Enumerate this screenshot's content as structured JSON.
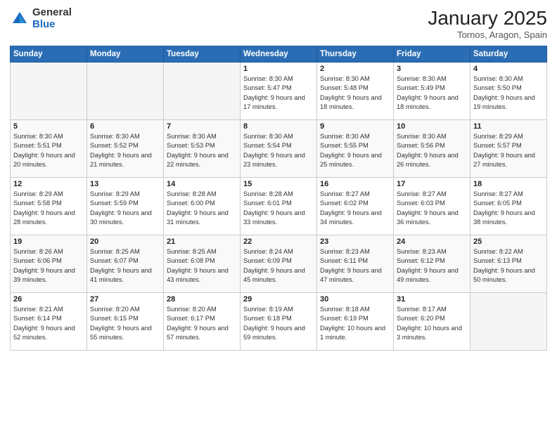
{
  "header": {
    "logo_general": "General",
    "logo_blue": "Blue",
    "month_title": "January 2025",
    "location": "Tornos, Aragon, Spain"
  },
  "weekdays": [
    "Sunday",
    "Monday",
    "Tuesday",
    "Wednesday",
    "Thursday",
    "Friday",
    "Saturday"
  ],
  "weeks": [
    [
      {
        "day": null
      },
      {
        "day": null
      },
      {
        "day": null
      },
      {
        "day": "1",
        "sunrise": "Sunrise: 8:30 AM",
        "sunset": "Sunset: 5:47 PM",
        "daylight": "Daylight: 9 hours and 17 minutes."
      },
      {
        "day": "2",
        "sunrise": "Sunrise: 8:30 AM",
        "sunset": "Sunset: 5:48 PM",
        "daylight": "Daylight: 9 hours and 18 minutes."
      },
      {
        "day": "3",
        "sunrise": "Sunrise: 8:30 AM",
        "sunset": "Sunset: 5:49 PM",
        "daylight": "Daylight: 9 hours and 18 minutes."
      },
      {
        "day": "4",
        "sunrise": "Sunrise: 8:30 AM",
        "sunset": "Sunset: 5:50 PM",
        "daylight": "Daylight: 9 hours and 19 minutes."
      }
    ],
    [
      {
        "day": "5",
        "sunrise": "Sunrise: 8:30 AM",
        "sunset": "Sunset: 5:51 PM",
        "daylight": "Daylight: 9 hours and 20 minutes."
      },
      {
        "day": "6",
        "sunrise": "Sunrise: 8:30 AM",
        "sunset": "Sunset: 5:52 PM",
        "daylight": "Daylight: 9 hours and 21 minutes."
      },
      {
        "day": "7",
        "sunrise": "Sunrise: 8:30 AM",
        "sunset": "Sunset: 5:53 PM",
        "daylight": "Daylight: 9 hours and 22 minutes."
      },
      {
        "day": "8",
        "sunrise": "Sunrise: 8:30 AM",
        "sunset": "Sunset: 5:54 PM",
        "daylight": "Daylight: 9 hours and 23 minutes."
      },
      {
        "day": "9",
        "sunrise": "Sunrise: 8:30 AM",
        "sunset": "Sunset: 5:55 PM",
        "daylight": "Daylight: 9 hours and 25 minutes."
      },
      {
        "day": "10",
        "sunrise": "Sunrise: 8:30 AM",
        "sunset": "Sunset: 5:56 PM",
        "daylight": "Daylight: 9 hours and 26 minutes."
      },
      {
        "day": "11",
        "sunrise": "Sunrise: 8:29 AM",
        "sunset": "Sunset: 5:57 PM",
        "daylight": "Daylight: 9 hours and 27 minutes."
      }
    ],
    [
      {
        "day": "12",
        "sunrise": "Sunrise: 8:29 AM",
        "sunset": "Sunset: 5:58 PM",
        "daylight": "Daylight: 9 hours and 28 minutes."
      },
      {
        "day": "13",
        "sunrise": "Sunrise: 8:29 AM",
        "sunset": "Sunset: 5:59 PM",
        "daylight": "Daylight: 9 hours and 30 minutes."
      },
      {
        "day": "14",
        "sunrise": "Sunrise: 8:28 AM",
        "sunset": "Sunset: 6:00 PM",
        "daylight": "Daylight: 9 hours and 31 minutes."
      },
      {
        "day": "15",
        "sunrise": "Sunrise: 8:28 AM",
        "sunset": "Sunset: 6:01 PM",
        "daylight": "Daylight: 9 hours and 33 minutes."
      },
      {
        "day": "16",
        "sunrise": "Sunrise: 8:27 AM",
        "sunset": "Sunset: 6:02 PM",
        "daylight": "Daylight: 9 hours and 34 minutes."
      },
      {
        "day": "17",
        "sunrise": "Sunrise: 8:27 AM",
        "sunset": "Sunset: 6:03 PM",
        "daylight": "Daylight: 9 hours and 36 minutes."
      },
      {
        "day": "18",
        "sunrise": "Sunrise: 8:27 AM",
        "sunset": "Sunset: 6:05 PM",
        "daylight": "Daylight: 9 hours and 38 minutes."
      }
    ],
    [
      {
        "day": "19",
        "sunrise": "Sunrise: 8:26 AM",
        "sunset": "Sunset: 6:06 PM",
        "daylight": "Daylight: 9 hours and 39 minutes."
      },
      {
        "day": "20",
        "sunrise": "Sunrise: 8:25 AM",
        "sunset": "Sunset: 6:07 PM",
        "daylight": "Daylight: 9 hours and 41 minutes."
      },
      {
        "day": "21",
        "sunrise": "Sunrise: 8:25 AM",
        "sunset": "Sunset: 6:08 PM",
        "daylight": "Daylight: 9 hours and 43 minutes."
      },
      {
        "day": "22",
        "sunrise": "Sunrise: 8:24 AM",
        "sunset": "Sunset: 6:09 PM",
        "daylight": "Daylight: 9 hours and 45 minutes."
      },
      {
        "day": "23",
        "sunrise": "Sunrise: 8:23 AM",
        "sunset": "Sunset: 6:11 PM",
        "daylight": "Daylight: 9 hours and 47 minutes."
      },
      {
        "day": "24",
        "sunrise": "Sunrise: 8:23 AM",
        "sunset": "Sunset: 6:12 PM",
        "daylight": "Daylight: 9 hours and 49 minutes."
      },
      {
        "day": "25",
        "sunrise": "Sunrise: 8:22 AM",
        "sunset": "Sunset: 6:13 PM",
        "daylight": "Daylight: 9 hours and 50 minutes."
      }
    ],
    [
      {
        "day": "26",
        "sunrise": "Sunrise: 8:21 AM",
        "sunset": "Sunset: 6:14 PM",
        "daylight": "Daylight: 9 hours and 52 minutes."
      },
      {
        "day": "27",
        "sunrise": "Sunrise: 8:20 AM",
        "sunset": "Sunset: 6:15 PM",
        "daylight": "Daylight: 9 hours and 55 minutes."
      },
      {
        "day": "28",
        "sunrise": "Sunrise: 8:20 AM",
        "sunset": "Sunset: 6:17 PM",
        "daylight": "Daylight: 9 hours and 57 minutes."
      },
      {
        "day": "29",
        "sunrise": "Sunrise: 8:19 AM",
        "sunset": "Sunset: 6:18 PM",
        "daylight": "Daylight: 9 hours and 59 minutes."
      },
      {
        "day": "30",
        "sunrise": "Sunrise: 8:18 AM",
        "sunset": "Sunset: 6:19 PM",
        "daylight": "Daylight: 10 hours and 1 minute."
      },
      {
        "day": "31",
        "sunrise": "Sunrise: 8:17 AM",
        "sunset": "Sunset: 6:20 PM",
        "daylight": "Daylight: 10 hours and 3 minutes."
      },
      {
        "day": null
      }
    ]
  ]
}
